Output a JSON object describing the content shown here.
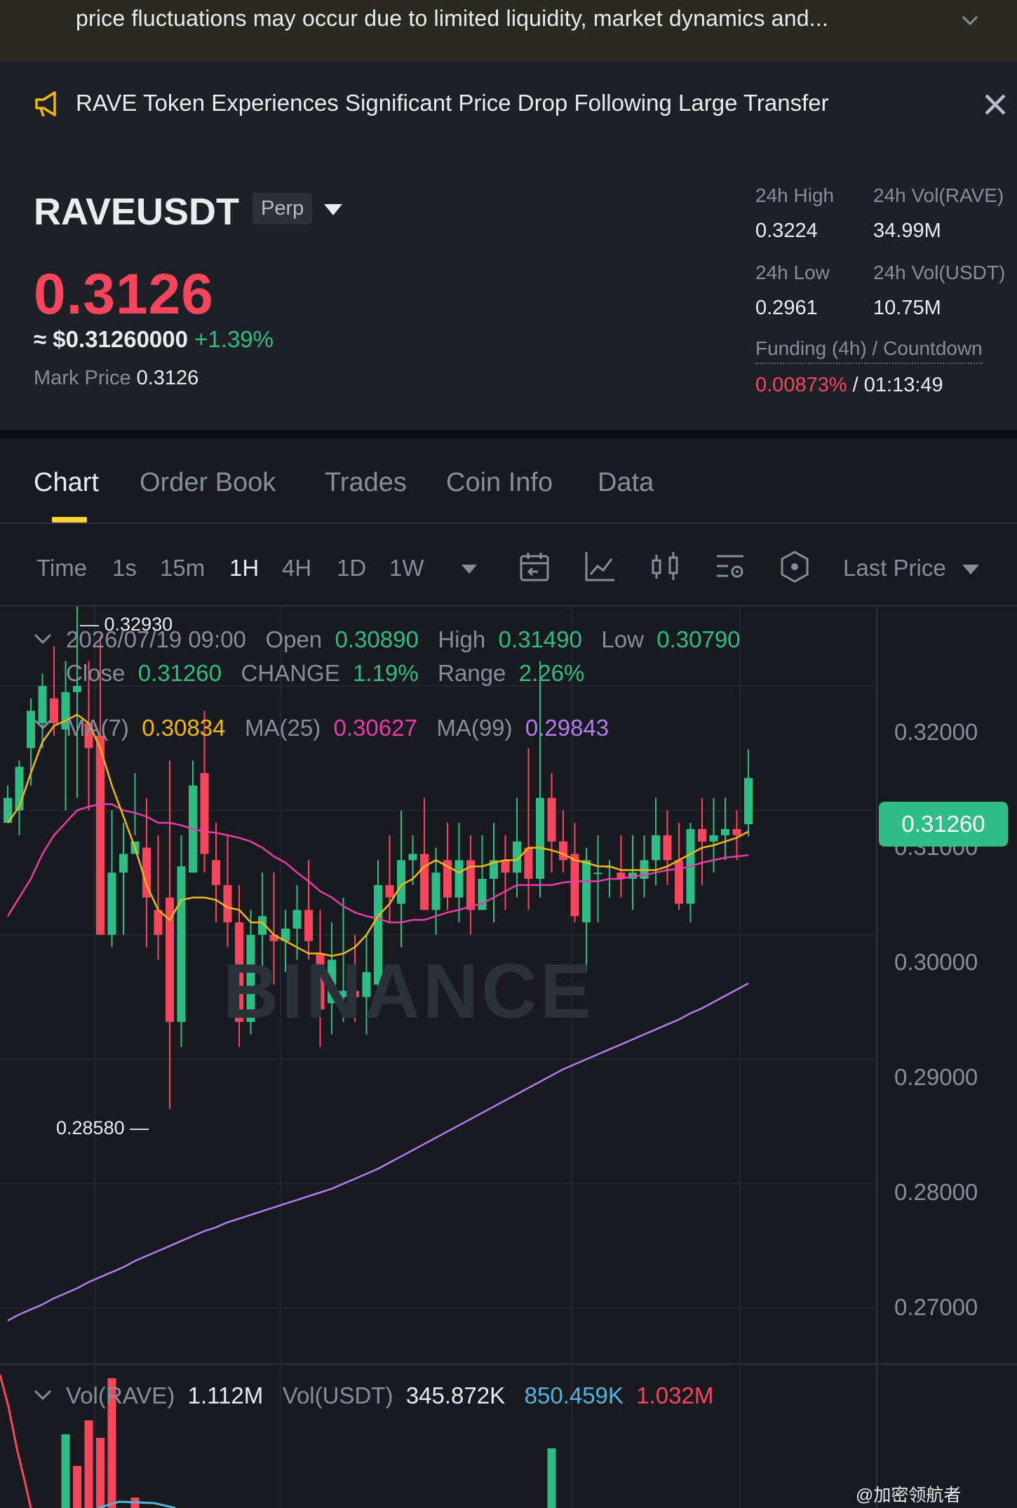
{
  "banner": {
    "text": "price fluctuations may occur due to limited liquidity, market dynamics and..."
  },
  "news": {
    "headline": "RAVE Token Experiences Significant Price Drop Following Large Transfer"
  },
  "ticker": {
    "symbol": "RAVEUSDT",
    "contract": "Perp",
    "last_price": "0.3126",
    "usd_price": "≈ $0.31260000",
    "change": "+1.39%",
    "mark_label": "Mark Price",
    "mark_value": "0.3126"
  },
  "stats": {
    "high_label": "24h High",
    "high_value": "0.3224",
    "low_label": "24h Low",
    "low_value": "0.2961",
    "vol_rave_label": "24h Vol(RAVE)",
    "vol_rave_value": "34.99M",
    "vol_usdt_label": "24h Vol(USDT)",
    "vol_usdt_value": "10.75M",
    "funding_label": "Funding (4h) / Countdown",
    "funding_rate": "0.00873%",
    "funding_sep": " / ",
    "countdown": "01:13:49"
  },
  "tabs": [
    "Chart",
    "Order Book",
    "Trades",
    "Coin Info",
    "Data"
  ],
  "timeframes": [
    "Time",
    "1s",
    "15m",
    "1H",
    "4H",
    "1D",
    "1W"
  ],
  "price_source": "Last Price",
  "ohlc": {
    "date": "2026/07/19 09:00",
    "open_label": "Open",
    "open": "0.30890",
    "high_label": "High",
    "high": "0.31490",
    "low_label": "Low",
    "low": "0.30790",
    "close_label": "Close",
    "close": "0.31260",
    "change_label": "CHANGE",
    "change": "1.19%",
    "range_label": "Range",
    "range": "2.26%"
  },
  "ma": {
    "ma7_label": "MA(7)",
    "ma7": "0.30834",
    "ma25_label": "MA(25)",
    "ma25": "0.30627",
    "ma99_label": "MA(99)",
    "ma99": "0.29843"
  },
  "volume": {
    "label": "Vol(RAVE)",
    "rave": "1.112M",
    "usdt_label": "Vol(USDT)",
    "usdt": "345.872K",
    "ma1": "850.459K",
    "ma2": "1.032M"
  },
  "watermark": "BINANCE",
  "credit": "@加密领航者",
  "colors": {
    "up": "#2ebd85",
    "down": "#f6465d",
    "ma7": "#f0b90b",
    "ma25": "#e93ca8",
    "ma99": "#b17df0",
    "accent": "#fcd535"
  },
  "chart_data": {
    "type": "candlestick",
    "interval": "1H",
    "y_ticks": [
      "0.32000",
      "0.31000",
      "0.30000",
      "0.29000",
      "0.28000",
      "0.27000"
    ],
    "ylim": [
      0.2655,
      0.3258
    ],
    "last_price_tag": "0.31260",
    "high_marker": "0.32930",
    "low_marker": "0.28580",
    "candles": [
      {
        "o": 0.309,
        "h": 0.312,
        "l": 0.309,
        "c": 0.311
      },
      {
        "o": 0.31,
        "h": 0.314,
        "l": 0.308,
        "c": 0.3135
      },
      {
        "o": 0.315,
        "h": 0.319,
        "l": 0.312,
        "c": 0.318
      },
      {
        "o": 0.317,
        "h": 0.321,
        "l": 0.315,
        "c": 0.32
      },
      {
        "o": 0.319,
        "h": 0.3232,
        "l": 0.316,
        "c": 0.317
      },
      {
        "o": 0.3165,
        "h": 0.322,
        "l": 0.31,
        "c": 0.3195
      },
      {
        "o": 0.3195,
        "h": 0.327,
        "l": 0.311,
        "c": 0.32
      },
      {
        "o": 0.317,
        "h": 0.322,
        "l": 0.31,
        "c": 0.315
      },
      {
        "o": 0.316,
        "h": 0.324,
        "l": 0.302,
        "c": 0.3
      },
      {
        "o": 0.3,
        "h": 0.31,
        "l": 0.299,
        "c": 0.305
      },
      {
        "o": 0.305,
        "h": 0.309,
        "l": 0.3,
        "c": 0.3065
      },
      {
        "o": 0.3065,
        "h": 0.313,
        "l": 0.308,
        "c": 0.3075
      },
      {
        "o": 0.307,
        "h": 0.311,
        "l": 0.299,
        "c": 0.303
      },
      {
        "o": 0.302,
        "h": 0.308,
        "l": 0.298,
        "c": 0.3
      },
      {
        "o": 0.303,
        "h": 0.314,
        "l": 0.286,
        "c": 0.293
      },
      {
        "o": 0.293,
        "h": 0.308,
        "l": 0.291,
        "c": 0.3055
      },
      {
        "o": 0.305,
        "h": 0.314,
        "l": 0.306,
        "c": 0.312
      },
      {
        "o": 0.313,
        "h": 0.318,
        "l": 0.305,
        "c": 0.3065
      },
      {
        "o": 0.306,
        "h": 0.309,
        "l": 0.301,
        "c": 0.304
      },
      {
        "o": 0.304,
        "h": 0.308,
        "l": 0.299,
        "c": 0.301
      },
      {
        "o": 0.301,
        "h": 0.304,
        "l": 0.291,
        "c": 0.293
      },
      {
        "o": 0.293,
        "h": 0.302,
        "l": 0.292,
        "c": 0.3
      },
      {
        "o": 0.3,
        "h": 0.305,
        "l": 0.295,
        "c": 0.3015
      },
      {
        "o": 0.3,
        "h": 0.305,
        "l": 0.296,
        "c": 0.2995
      },
      {
        "o": 0.2995,
        "h": 0.302,
        "l": 0.297,
        "c": 0.3005
      },
      {
        "o": 0.3005,
        "h": 0.304,
        "l": 0.298,
        "c": 0.302
      },
      {
        "o": 0.302,
        "h": 0.306,
        "l": 0.298,
        "c": 0.2995
      },
      {
        "o": 0.2985,
        "h": 0.302,
        "l": 0.291,
        "c": 0.294
      },
      {
        "o": 0.2945,
        "h": 0.301,
        "l": 0.292,
        "c": 0.298
      },
      {
        "o": 0.295,
        "h": 0.303,
        "l": 0.293,
        "c": 0.2955
      },
      {
        "o": 0.2955,
        "h": 0.3,
        "l": 0.293,
        "c": 0.295
      },
      {
        "o": 0.295,
        "h": 0.3,
        "l": 0.292,
        "c": 0.297
      },
      {
        "o": 0.296,
        "h": 0.306,
        "l": 0.294,
        "c": 0.304
      },
      {
        "o": 0.304,
        "h": 0.308,
        "l": 0.301,
        "c": 0.303
      },
      {
        "o": 0.3025,
        "h": 0.31,
        "l": 0.299,
        "c": 0.306
      },
      {
        "o": 0.306,
        "h": 0.308,
        "l": 0.304,
        "c": 0.3065
      },
      {
        "o": 0.3065,
        "h": 0.311,
        "l": 0.302,
        "c": 0.302
      },
      {
        "o": 0.302,
        "h": 0.307,
        "l": 0.3,
        "c": 0.305
      },
      {
        "o": 0.306,
        "h": 0.309,
        "l": 0.302,
        "c": 0.303
      },
      {
        "o": 0.303,
        "h": 0.309,
        "l": 0.301,
        "c": 0.306
      },
      {
        "o": 0.306,
        "h": 0.308,
        "l": 0.3,
        "c": 0.302
      },
      {
        "o": 0.302,
        "h": 0.308,
        "l": 0.302,
        "c": 0.3045
      },
      {
        "o": 0.3045,
        "h": 0.309,
        "l": 0.301,
        "c": 0.306
      },
      {
        "o": 0.306,
        "h": 0.308,
        "l": 0.302,
        "c": 0.305
      },
      {
        "o": 0.305,
        "h": 0.311,
        "l": 0.303,
        "c": 0.3075
      },
      {
        "o": 0.307,
        "h": 0.315,
        "l": 0.302,
        "c": 0.3045
      },
      {
        "o": 0.3045,
        "h": 0.322,
        "l": 0.303,
        "c": 0.311
      },
      {
        "o": 0.311,
        "h": 0.313,
        "l": 0.305,
        "c": 0.3075
      },
      {
        "o": 0.3075,
        "h": 0.31,
        "l": 0.305,
        "c": 0.306
      },
      {
        "o": 0.3065,
        "h": 0.309,
        "l": 0.301,
        "c": 0.3015
      },
      {
        "o": 0.301,
        "h": 0.307,
        "l": 0.297,
        "c": 0.306
      },
      {
        "o": 0.305,
        "h": 0.308,
        "l": 0.301,
        "c": 0.305
      },
      {
        "o": 0.3055,
        "h": 0.306,
        "l": 0.303,
        "c": 0.3055
      },
      {
        "o": 0.305,
        "h": 0.308,
        "l": 0.303,
        "c": 0.3045
      },
      {
        "o": 0.3045,
        "h": 0.308,
        "l": 0.302,
        "c": 0.305
      },
      {
        "o": 0.3045,
        "h": 0.308,
        "l": 0.303,
        "c": 0.306
      },
      {
        "o": 0.306,
        "h": 0.311,
        "l": 0.304,
        "c": 0.308
      },
      {
        "o": 0.308,
        "h": 0.31,
        "l": 0.304,
        "c": 0.306
      },
      {
        "o": 0.306,
        "h": 0.309,
        "l": 0.302,
        "c": 0.3025
      },
      {
        "o": 0.3025,
        "h": 0.309,
        "l": 0.301,
        "c": 0.3085
      },
      {
        "o": 0.3085,
        "h": 0.311,
        "l": 0.304,
        "c": 0.3075
      },
      {
        "o": 0.3075,
        "h": 0.311,
        "l": 0.305,
        "c": 0.308
      },
      {
        "o": 0.308,
        "h": 0.311,
        "l": 0.306,
        "c": 0.3085
      },
      {
        "o": 0.3085,
        "h": 0.31,
        "l": 0.306,
        "c": 0.308
      },
      {
        "o": 0.3089,
        "h": 0.3149,
        "l": 0.3079,
        "c": 0.3126
      }
    ],
    "ma7": [
      0.309,
      0.3103,
      0.313,
      0.3155,
      0.3168,
      0.3172,
      0.3177,
      0.317,
      0.315,
      0.312,
      0.3095,
      0.307,
      0.304,
      0.302,
      0.3012,
      0.3028,
      0.303,
      0.303,
      0.3028,
      0.3022,
      0.302,
      0.301,
      0.301,
      0.3,
      0.2995,
      0.299,
      0.2985,
      0.2985,
      0.2983,
      0.2985,
      0.299,
      0.3,
      0.3015,
      0.3025,
      0.304,
      0.3045,
      0.3055,
      0.306,
      0.3055,
      0.305,
      0.3055,
      0.3055,
      0.3058,
      0.306,
      0.306,
      0.307,
      0.307,
      0.3068,
      0.3065,
      0.306,
      0.3058,
      0.3055,
      0.3055,
      0.3052,
      0.3052,
      0.3052,
      0.3052,
      0.3055,
      0.306,
      0.3065,
      0.307,
      0.3072,
      0.3075,
      0.3078,
      0.3083
    ],
    "ma25": [
      0.3015,
      0.303,
      0.3045,
      0.3065,
      0.308,
      0.309,
      0.31,
      0.3103,
      0.3105,
      0.3105,
      0.31,
      0.3098,
      0.3095,
      0.309,
      0.309,
      0.3088,
      0.3085,
      0.3083,
      0.3082,
      0.308,
      0.3078,
      0.3075,
      0.307,
      0.3063,
      0.3058,
      0.305,
      0.3043,
      0.3035,
      0.303,
      0.3023,
      0.3018,
      0.3015,
      0.3013,
      0.301,
      0.301,
      0.3012,
      0.3012,
      0.3015,
      0.3018,
      0.302,
      0.3023,
      0.3025,
      0.303,
      0.3035,
      0.304,
      0.304,
      0.304,
      0.304,
      0.3042,
      0.3043,
      0.3043,
      0.3043,
      0.3045,
      0.3045,
      0.3047,
      0.3048,
      0.305,
      0.3052,
      0.3053,
      0.3055,
      0.3058,
      0.306,
      0.3062,
      0.3063,
      0.3064
    ],
    "ma99": [
      0.269,
      0.2695,
      0.2699,
      0.2703,
      0.2708,
      0.2712,
      0.2716,
      0.2721,
      0.2725,
      0.2729,
      0.2733,
      0.2738,
      0.2742,
      0.2746,
      0.275,
      0.2754,
      0.2758,
      0.2762,
      0.2765,
      0.2769,
      0.2772,
      0.2775,
      0.2778,
      0.2781,
      0.2784,
      0.2787,
      0.279,
      0.2793,
      0.2796,
      0.28,
      0.2804,
      0.2808,
      0.2812,
      0.2817,
      0.2822,
      0.2827,
      0.2832,
      0.2837,
      0.2842,
      0.2847,
      0.2852,
      0.2857,
      0.2862,
      0.2867,
      0.2872,
      0.2877,
      0.2882,
      0.2887,
      0.2892,
      0.2896,
      0.29,
      0.2904,
      0.2908,
      0.2912,
      0.2916,
      0.292,
      0.2924,
      0.2928,
      0.2932,
      0.2937,
      0.2941,
      0.2946,
      0.2951,
      0.2956,
      0.2961
    ]
  }
}
